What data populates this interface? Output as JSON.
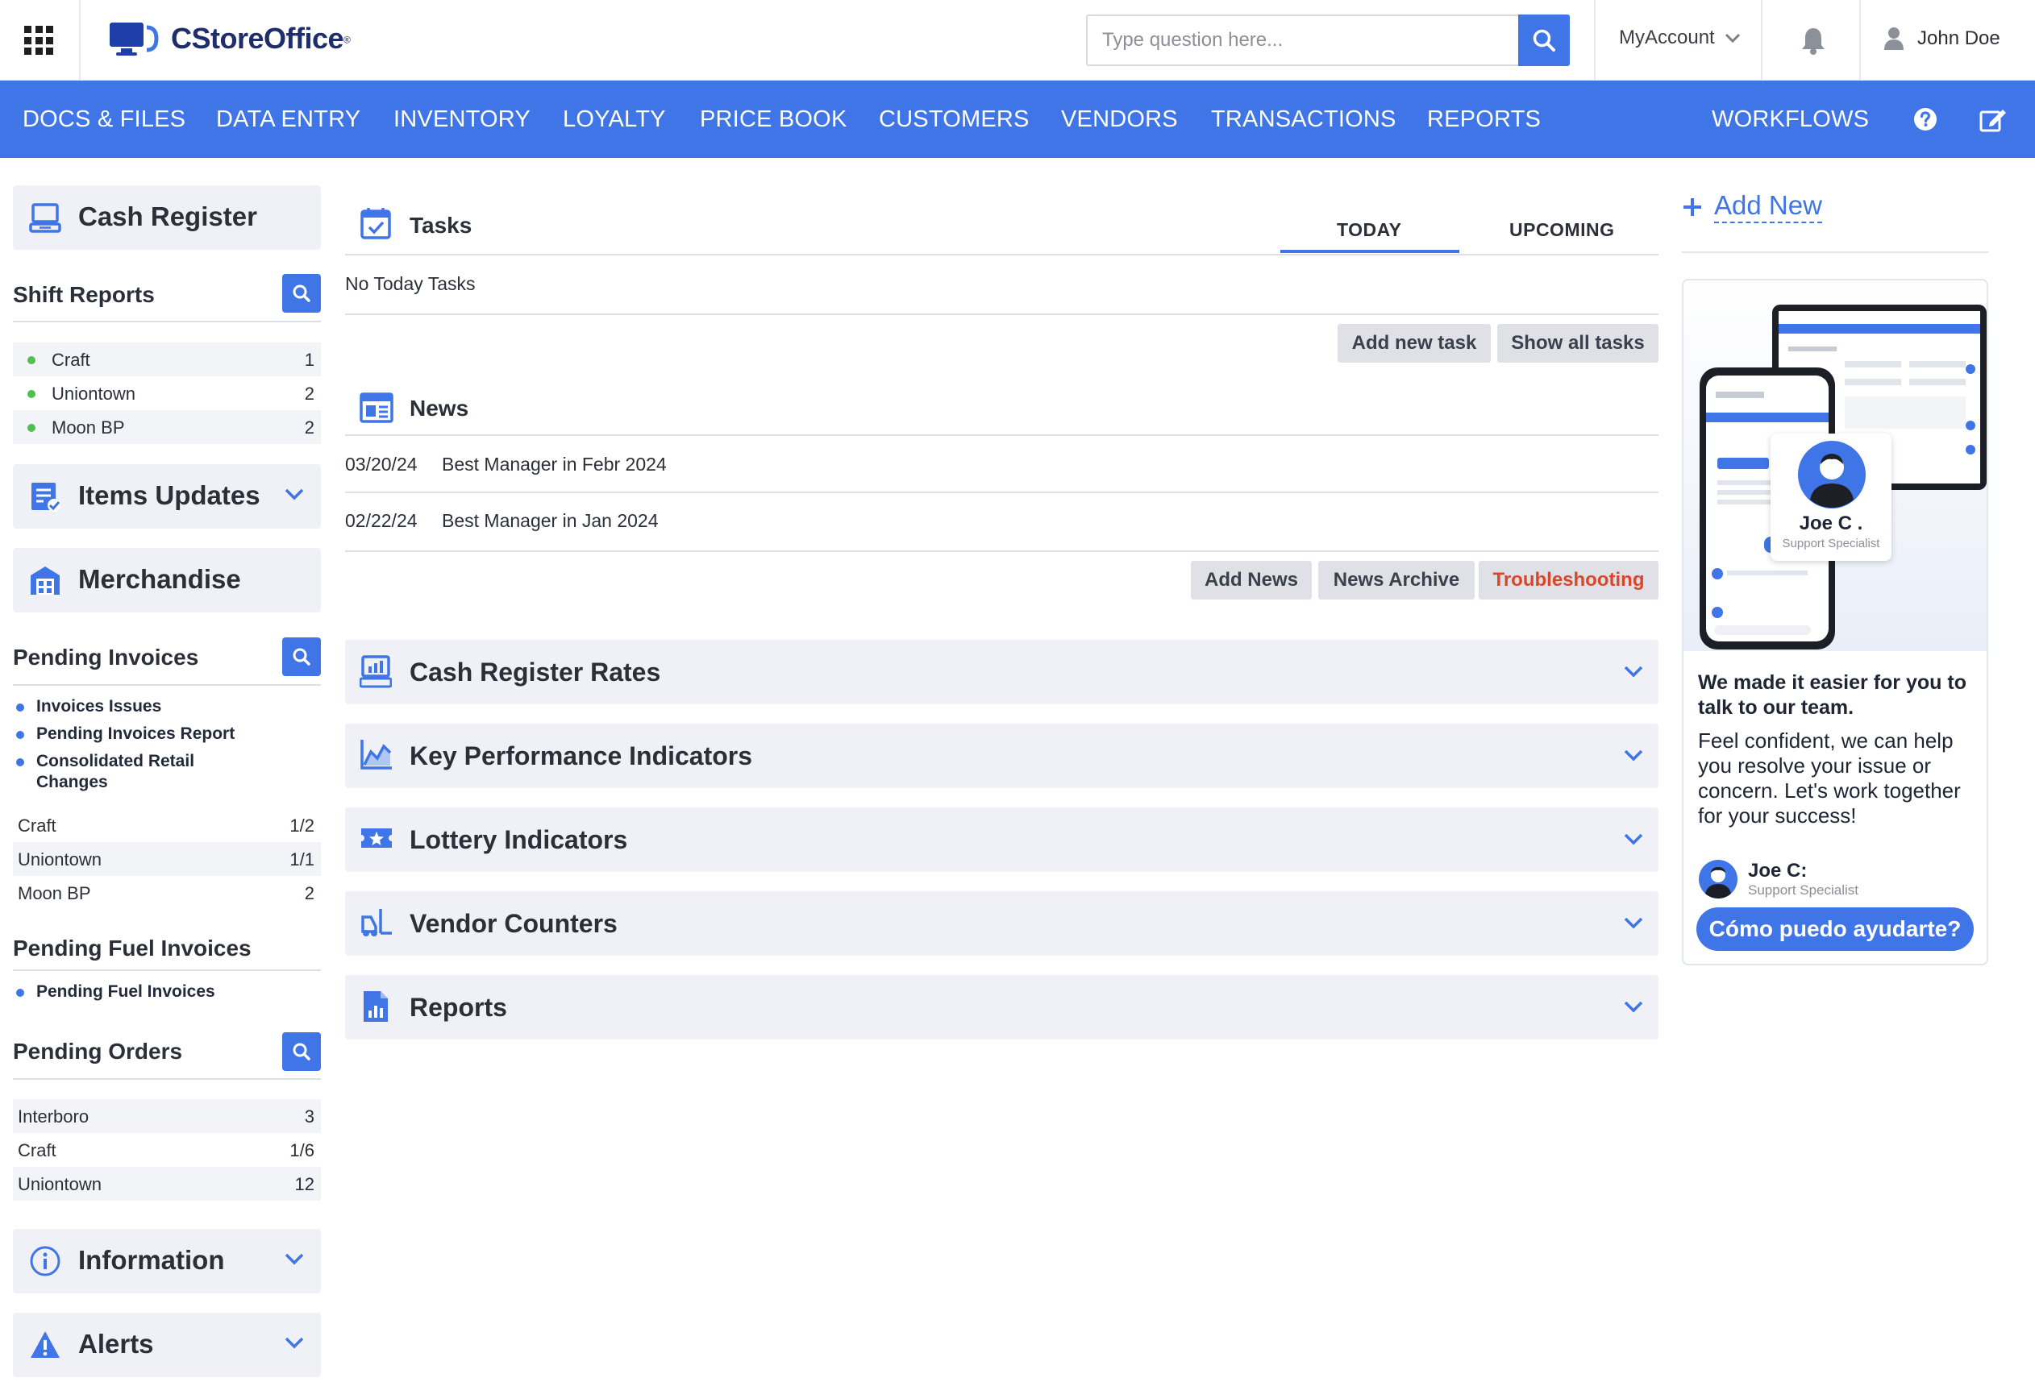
{
  "app": {
    "logo_text": "CStoreOffice",
    "logo_reg": "®"
  },
  "header": {
    "search_placeholder": "Type question here...",
    "my_account": "MyAccount",
    "user_name": "John Doe"
  },
  "nav": {
    "items": [
      "DOCS & FILES",
      "DATA ENTRY",
      "INVENTORY",
      "LOYALTY",
      "PRICE BOOK",
      "CUSTOMERS",
      "VENDORS",
      "TRANSACTIONS",
      "REPORTS"
    ],
    "workflows": "WORKFLOWS"
  },
  "sidebar": {
    "cash_register": "Cash Register",
    "shift_reports": {
      "title": "Shift Reports",
      "rows": [
        {
          "label": "Craft",
          "count": "1"
        },
        {
          "label": "Uniontown",
          "count": "2"
        },
        {
          "label": "Moon BP",
          "count": "2"
        }
      ]
    },
    "items_updates": "Items Updates",
    "merchandise": "Merchandise",
    "pending_invoices": {
      "title": "Pending Invoices",
      "links": [
        "Invoices Issues",
        "Pending Invoices Report",
        "Consolidated Retail Changes"
      ],
      "rows": [
        {
          "label": "Craft",
          "count": "1/2"
        },
        {
          "label": "Uniontown",
          "count": "1/1"
        },
        {
          "label": "Moon BP",
          "count": "2"
        }
      ]
    },
    "pending_fuel_invoices": {
      "title": "Pending Fuel Invoices",
      "links": [
        "Pending Fuel Invoices"
      ]
    },
    "pending_orders": {
      "title": "Pending Orders",
      "rows": [
        {
          "label": "Interboro",
          "count": "3"
        },
        {
          "label": "Craft",
          "count": "1/6"
        },
        {
          "label": "Uniontown",
          "count": "12"
        }
      ]
    },
    "information": "Information",
    "alerts": "Alerts"
  },
  "tasks": {
    "title": "Tasks",
    "tab_today": "TODAY",
    "tab_upcoming": "UPCOMING",
    "empty_text": "No Today Tasks",
    "add_task": "Add new task",
    "show_all": "Show all tasks"
  },
  "news": {
    "title": "News",
    "items": [
      {
        "date": "03/20/24",
        "title": "Best Manager in Febr 2024"
      },
      {
        "date": "02/22/24",
        "title": "Best Manager in Jan 2024"
      }
    ],
    "add_news": "Add News",
    "archive": "News Archive",
    "troubleshooting": "Troubleshooting"
  },
  "panels": [
    "Cash Register Rates",
    "Key Performance Indicators",
    "Lottery Indicators",
    "Vendor Counters",
    "Reports"
  ],
  "right": {
    "add_new": "Add New",
    "promo_headline": "We made it easier for you to talk to our team.",
    "promo_body": "Feel confident, we can help you resolve your issue or concern. Let's work together for your success!",
    "agent_name": "Joe C:",
    "agent_role": "Support Specialist",
    "image_agent_name": "Joe C .",
    "image_agent_role": "Support Specialist",
    "cta": "Cómo puedo ayudarte?"
  },
  "colors": {
    "accent": "#3f75e6",
    "danger": "#d9472b",
    "panel_bg": "#eff1f6",
    "status_green": "#4fbf52"
  }
}
